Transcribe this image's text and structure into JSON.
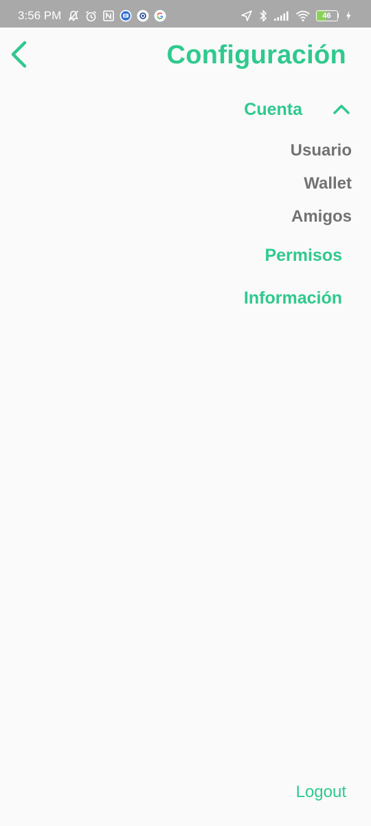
{
  "status_bar": {
    "time": "3:56 PM",
    "battery_level": "46",
    "battery_fraction": 0.46,
    "left_icons": [
      "notifications-off-icon",
      "alarm-icon",
      "nfc-icon",
      "messages-icon",
      "app-icon",
      "google-icon"
    ],
    "right_icons": [
      "location-icon",
      "bluetooth-icon",
      "signal-icon",
      "wifi-icon",
      "battery-icon",
      "charging-icon"
    ],
    "battery_color": "#8bd15a"
  },
  "header": {
    "title": "Configuración",
    "back_icon": "chevron-left-icon"
  },
  "menu": {
    "account": {
      "label": "Cuenta",
      "expanded": true,
      "toggle_icon": "chevron-up-icon",
      "items": [
        "Usuario",
        "Wallet",
        "Amigos"
      ]
    },
    "permissions_label": "Permisos",
    "information_label": "Información"
  },
  "footer": {
    "logout_label": "Logout"
  },
  "colors": {
    "accent": "#2fc98e",
    "subitem_text": "#727272",
    "background": "#fafafa",
    "status_bar": "#a9a9a9"
  }
}
